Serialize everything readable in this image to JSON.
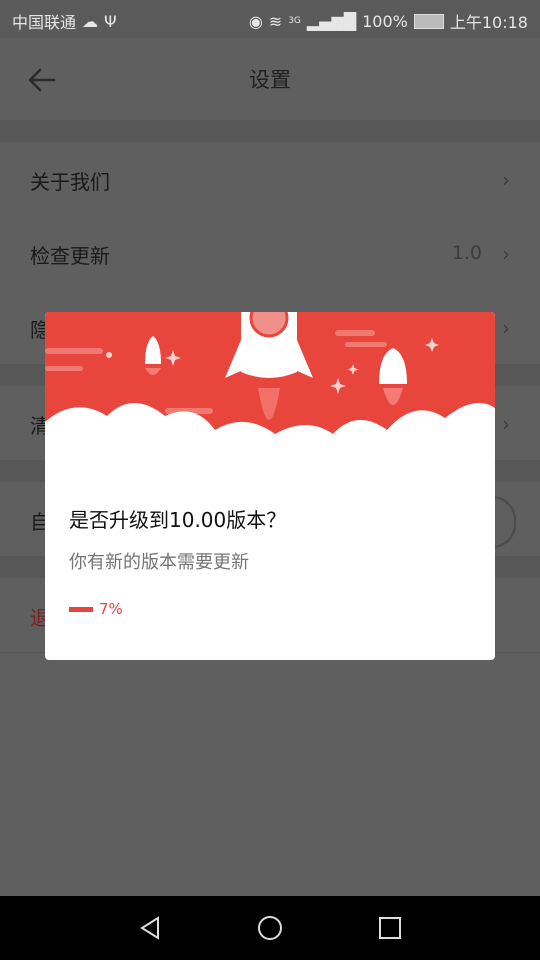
{
  "status_bar": {
    "carrier": "中国联通",
    "battery": "100%",
    "time": "上午10:18",
    "network": "3G"
  },
  "app_bar": {
    "title": "设置"
  },
  "settings": {
    "items": [
      {
        "label": "关于我们"
      },
      {
        "label": "检查更新",
        "value": "1.0"
      },
      {
        "label": "隐"
      },
      {
        "label": "清"
      },
      {
        "label": "自"
      },
      {
        "label": "退"
      }
    ]
  },
  "dialog": {
    "title": "是否升级到10.00版本？",
    "message": "你有新的版本需要更新",
    "progress_percent": 7,
    "progress_label": "7%"
  },
  "colors": {
    "accent_red": "#e8453c",
    "dim_overlay": "#5f5f5f"
  }
}
